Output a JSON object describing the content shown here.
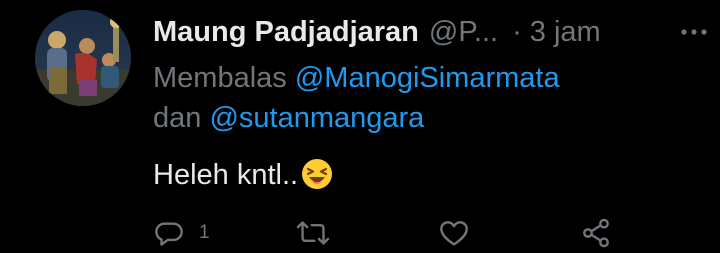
{
  "tweet": {
    "display_name": "Maung Padjadjaran",
    "handle": "@P...",
    "separator": "·",
    "time": "3 jam",
    "reply_prefix": "Membalas",
    "reply_mention_1": "@ManogiSimarmata",
    "reply_conjunction": "dan",
    "reply_mention_2": "@sutanmangara",
    "text": "Heleh kntl..",
    "emoji": "laughing-emoji"
  },
  "actions": {
    "reply_icon": "reply-icon",
    "reply_count": "1",
    "retweet_icon": "retweet-icon",
    "like_icon": "heart-icon",
    "share_icon": "share-icon"
  },
  "colors": {
    "background": "#000000",
    "primary_text": "#e7e9ea",
    "secondary_text": "#71767b",
    "link": "#1d9bf0"
  }
}
